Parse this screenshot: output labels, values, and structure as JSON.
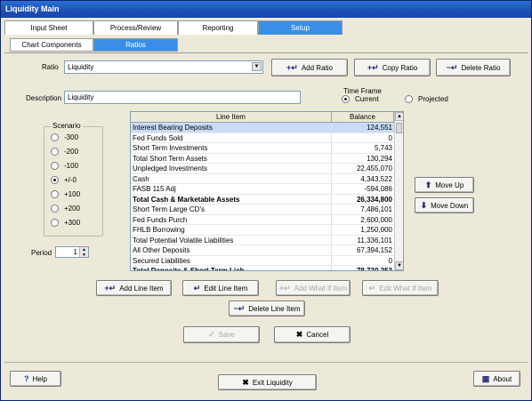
{
  "window": {
    "title": "Liquidity Main"
  },
  "tabs": [
    {
      "label": "Input Sheet"
    },
    {
      "label": "Process/Review"
    },
    {
      "label": "Reporting"
    },
    {
      "label": "Setup"
    }
  ],
  "subtabs": [
    {
      "label": "Chart Components"
    },
    {
      "label": "Ratios"
    }
  ],
  "ratio": {
    "label": "Ratio",
    "value": "Liquidity"
  },
  "buttons": {
    "add_ratio": "Add Ratio",
    "copy_ratio": "Copy Ratio",
    "delete_ratio": "Delete Ratio",
    "move_up": "Move Up",
    "move_down": "Move Down",
    "add_line_item": "Add Line Item",
    "edit_line_item": "Edit Line Item",
    "add_what_if": "Add What If Item",
    "edit_what_if": "Edit What If Item",
    "delete_line_item": "Delete Line Item",
    "save": "Save",
    "cancel": "Cancel",
    "help": "Help",
    "exit": "Exit Liquidity",
    "about": "About"
  },
  "description": {
    "label": "Description",
    "value": "Liquidity"
  },
  "timeframe": {
    "title": "Time Frame",
    "options": [
      {
        "label": "Current",
        "selected": true
      },
      {
        "label": "Projected",
        "selected": false
      }
    ]
  },
  "scenario": {
    "title": "Scenario",
    "options": [
      {
        "label": "-300",
        "selected": false
      },
      {
        "label": "-200",
        "selected": false
      },
      {
        "label": "-100",
        "selected": false
      },
      {
        "label": "+/-0",
        "selected": true
      },
      {
        "label": "+100",
        "selected": false
      },
      {
        "label": "+200",
        "selected": false
      },
      {
        "label": "+300",
        "selected": false
      }
    ]
  },
  "period": {
    "label": "Period",
    "value": "1"
  },
  "grid": {
    "headers": [
      "Line Item",
      "Balance"
    ],
    "rows": [
      {
        "item": "Interest Bearing Deposits",
        "balance": "124,551",
        "bold": false,
        "selected": true
      },
      {
        "item": "Fed Funds Sold",
        "balance": "0",
        "bold": false,
        "selected": false
      },
      {
        "item": "Short Term Investments",
        "balance": "5,743",
        "bold": false,
        "selected": false
      },
      {
        "item": "Total Short Term Assets",
        "balance": "130,294",
        "bold": false,
        "selected": false
      },
      {
        "item": "Unpledged Investments",
        "balance": "22,455,070",
        "bold": false,
        "selected": false
      },
      {
        "item": "Cash",
        "balance": "4,343,522",
        "bold": false,
        "selected": false
      },
      {
        "item": "FASB 115 Adj",
        "balance": "-594,086",
        "bold": false,
        "selected": false
      },
      {
        "item": "Total Cash & Marketable Assets",
        "balance": "26,334,800",
        "bold": true,
        "selected": false
      },
      {
        "item": "Short Term Large CD's",
        "balance": "7,486,101",
        "bold": false,
        "selected": false
      },
      {
        "item": "Fed Funds Purch",
        "balance": "2,600,000",
        "bold": false,
        "selected": false
      },
      {
        "item": "FHLB Borrowing",
        "balance": "1,250,000",
        "bold": false,
        "selected": false
      },
      {
        "item": "Total Potential Volatile Liabilities",
        "balance": "11,336,101",
        "bold": false,
        "selected": false
      },
      {
        "item": "All Other Deposits",
        "balance": "67,394,152",
        "bold": false,
        "selected": false
      },
      {
        "item": "Secured Liabilities",
        "balance": "0",
        "bold": false,
        "selected": false
      },
      {
        "item": "Total Deposits & Short Term Liab",
        "balance": "78,730,253",
        "bold": true,
        "selected": false
      }
    ]
  }
}
